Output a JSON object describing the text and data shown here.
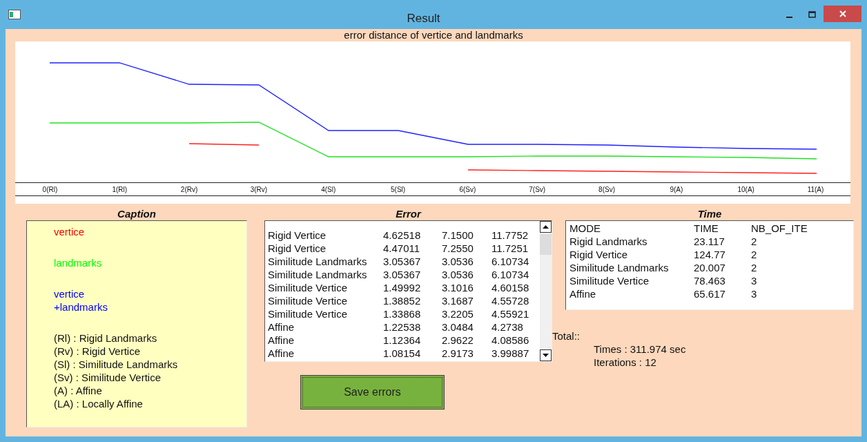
{
  "window": {
    "title": "Result"
  },
  "chart": {
    "title": "error distance of vertice and landmarks",
    "axis_labels": [
      "0(Rl)",
      "1(Rl)",
      "2(Rv)",
      "3(Rv)",
      "4(Sl)",
      "5(Sl)",
      "6(Sv)",
      "7(Sv)",
      "8(Sv)",
      "9(A)",
      "10(A)",
      "11(A)"
    ]
  },
  "caption": {
    "heading": "Caption",
    "legend": [
      {
        "lines": [
          "vertice"
        ],
        "color": "#ff0000"
      },
      {
        "lines": [
          "landmarks"
        ],
        "color": "#00ff00"
      },
      {
        "lines": [
          "vertice",
          "+landmarks"
        ],
        "color": "#0000ff"
      }
    ],
    "abbreviations": [
      "(Rl) : Rigid Landmarks",
      "(Rv) : Rigid Vertice",
      "(Sl) : Similitude Landmarks",
      "(Sv) : Similitude Vertice",
      "(A) : Affine",
      "(LA) : Locally Affine"
    ]
  },
  "error": {
    "heading": "Error",
    "rows": [
      [
        "Rigid Vertice",
        "4.62518",
        "7.1500",
        "11.7752"
      ],
      [
        "Rigid Vertice",
        "4.47011",
        "7.2550",
        "11.7251"
      ],
      [
        "Similitude Landmarks",
        "3.05367",
        "3.0536",
        "6.10734"
      ],
      [
        "Similitude Landmarks",
        "3.05367",
        "3.0536",
        "6.10734"
      ],
      [
        "Similitude Vertice",
        "1.49992",
        "3.1016",
        "4.60158"
      ],
      [
        "Similitude Vertice",
        "1.38852",
        "3.1687",
        "4.55728"
      ],
      [
        "Similitude Vertice",
        "1.33868",
        "3.2205",
        "4.55921"
      ],
      [
        "Affine",
        "1.22538",
        "3.0484",
        "4.2738"
      ],
      [
        "Affine",
        "1.12364",
        "2.9622",
        "4.08586"
      ],
      [
        "Affine",
        "1.08154",
        "2.9173",
        "3.99887"
      ]
    ]
  },
  "save_button": "Save errors",
  "time": {
    "heading": "Time",
    "columns": [
      "MODE",
      "TIME",
      "NB_OF_ITE"
    ],
    "rows": [
      [
        "Rigid Landmarks",
        "23.117",
        "2"
      ],
      [
        "Rigid Vertice",
        "124.77",
        "2"
      ],
      [
        "Similitude Landmarks",
        "20.007",
        "2"
      ],
      [
        "Similitude Vertice",
        "78.463",
        "3"
      ],
      [
        "Affine",
        "65.617",
        "3"
      ]
    ]
  },
  "total": {
    "label": "Total::",
    "times": "Times : 311.974 sec",
    "iterations": "Iterations : 12"
  }
}
